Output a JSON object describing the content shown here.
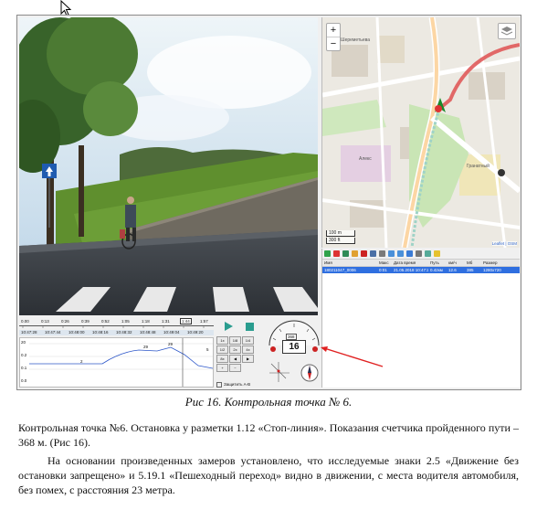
{
  "figure": {
    "caption": "Рис 16. Контрольная точка № 6.",
    "timeline": {
      "ticks": [
        "0.00",
        "0:13",
        "0:26",
        "0:39",
        "0:52",
        "1:05",
        "1:18",
        "1:31",
        "1:44",
        "1:57"
      ],
      "times": [
        "10:47:28",
        "10:47:44",
        "10:48:00",
        "10:48:16",
        "10:48:32",
        "10:48:48",
        "10:49:04",
        "10:49:20"
      ],
      "current": "1:44"
    },
    "graph": {
      "y_labels": [
        "20",
        "0.2",
        "0.1",
        "0.0"
      ],
      "markers": [
        "2",
        "29",
        "29"
      ],
      "right_label": "5",
      "checkbox_label": "Защитить A-B"
    },
    "controls": {
      "buttons": [
        "1x",
        "1/8",
        "1/4",
        "1/2",
        "2x",
        "4x",
        "8x"
      ]
    },
    "dashboard": {
      "speed": "16",
      "odometer": "368"
    },
    "map": {
      "zoom_in": "+",
      "zoom_out": "−",
      "labels": [
        "Шереметьева",
        "Алекс",
        "Гранатный"
      ],
      "scale": [
        "100 m",
        "300 ft"
      ],
      "attribution": "Leaflet | OSM"
    },
    "track_table": {
      "headers": [
        "Имя",
        "Макс",
        "Дата время",
        "Путь",
        "км/ч",
        "Мб",
        "Размер"
      ],
      "row": [
        "180211047_0006",
        "0:01",
        "21.05.2018 10:47:28",
        "0.42км",
        "12.6",
        "385",
        "1280x720"
      ]
    }
  },
  "text": {
    "paragraph1": "Контрольная точка №6. Остановка у разметки 1.12 «Стоп-линия». Показания  счетчика пройденного пути – 368 м. (Рис 16).",
    "paragraph2": "На основании произведенных замеров установлено, что исследуемые знаки 2.5 «Движение без остановки запрещено» и 5.19.1 «Пешеходный переход» видно в движении, с места водителя автомобиля, без помех,  с расстояния 23 метра."
  }
}
